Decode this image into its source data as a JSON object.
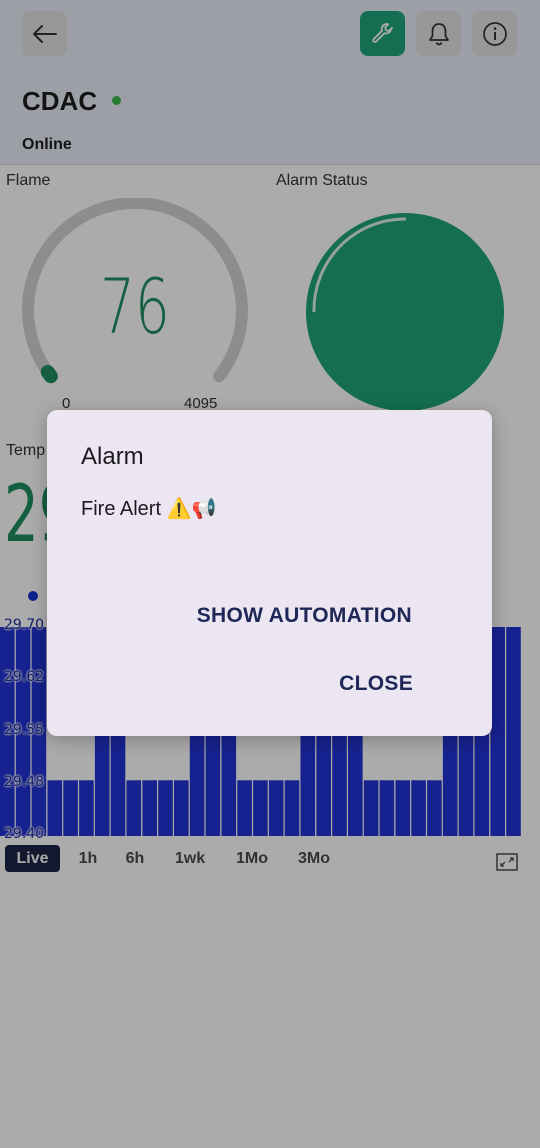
{
  "header": {
    "device_name": "CDAC",
    "status": "Online",
    "status_color": "#3cb54a",
    "icons": [
      "arrow-left-icon",
      "wrench-icon",
      "bell-icon",
      "info-icon"
    ]
  },
  "flame": {
    "label": "Flame",
    "value": "76",
    "min": "0",
    "max": "4095",
    "color": "#1f8e5e"
  },
  "alarm_status": {
    "label": "Alarm Status",
    "color": "#20a578"
  },
  "temperature": {
    "label": "Temp",
    "value": "29"
  },
  "chart": {
    "yticks": [
      "29.70",
      "29.62",
      "29.55",
      "29.48",
      "29.40"
    ]
  },
  "chart_data": {
    "type": "bar",
    "ylim": [
      29.4,
      29.7
    ],
    "values": [
      29.7,
      29.7,
      29.7,
      29.48,
      29.48,
      29.48,
      29.55,
      29.55,
      29.48,
      29.48,
      29.48,
      29.48,
      29.55,
      29.55,
      29.55,
      29.48,
      29.48,
      29.48,
      29.48,
      29.55,
      29.55,
      29.55,
      29.55,
      29.48,
      29.48,
      29.48,
      29.48,
      29.48,
      29.55,
      29.55,
      29.7,
      29.7,
      29.7
    ],
    "color": "#2233d6"
  },
  "time_ranges": [
    "Live",
    "1h",
    "6h",
    "1wk",
    "1Mo",
    "3Mo"
  ],
  "active_range": "Live",
  "dialog": {
    "title": "Alarm",
    "message": "Fire Alert ⚠️📢",
    "action_automation": "SHOW AUTOMATION",
    "action_close": "CLOSE"
  }
}
